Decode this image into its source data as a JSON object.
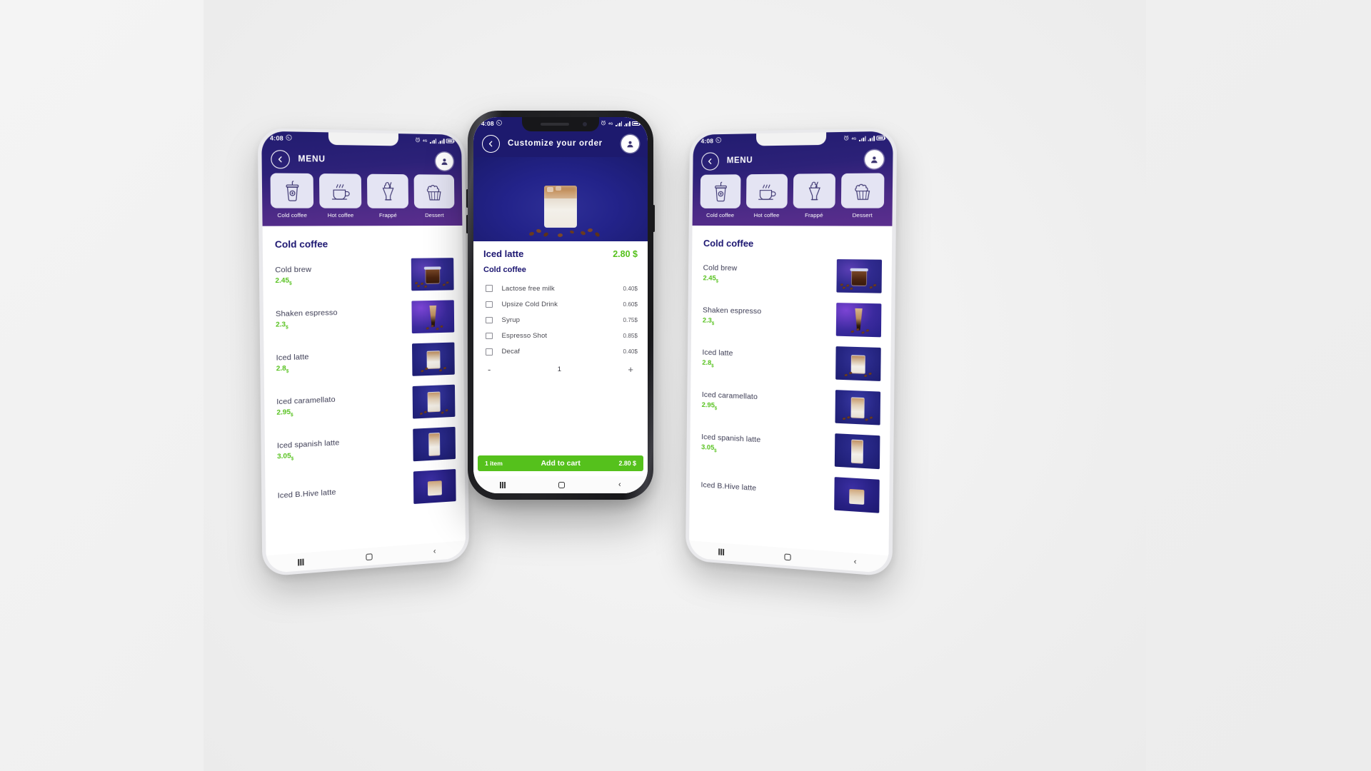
{
  "status_bar": {
    "time": "4:08",
    "whatsapp_icon": "whatsapp-icon",
    "alarm_icon": "alarm-icon",
    "signal_icon": "signal-icon",
    "battery_icon": "battery-icon"
  },
  "colors": {
    "header_start": "#221c70",
    "header_end": "#5b2e8e",
    "accent_green": "#55c11c",
    "brand_navy": "#1b1570",
    "tile_bg": "#e4e4f3"
  },
  "menu_screen": {
    "title": "MENU",
    "back_icon": "chevron-left-icon",
    "profile_icon": "user-avatar-icon",
    "categories": [
      {
        "label": "Cold coffee",
        "icon": "iced-cup-icon"
      },
      {
        "label": "Hot coffee",
        "icon": "hot-cup-icon"
      },
      {
        "label": "Frappé",
        "icon": "frappe-glass-icon"
      },
      {
        "label": "Dessert",
        "icon": "cupcake-icon"
      }
    ],
    "section_title": "Cold coffee",
    "items": [
      {
        "name": "Cold brew",
        "price": "2.45",
        "currency": "$"
      },
      {
        "name": "Shaken espresso",
        "price": "2.3",
        "currency": "$"
      },
      {
        "name": "Iced latte",
        "price": "2.8",
        "currency": "$"
      },
      {
        "name": "Iced caramellato",
        "price": "2.95",
        "currency": "$"
      },
      {
        "name": "Iced spanish latte",
        "price": "3.05",
        "currency": "$"
      },
      {
        "name": "Iced B.Hive latte",
        "price": "",
        "currency": ""
      }
    ]
  },
  "customize_screen": {
    "title": "Customize your order",
    "back_icon": "chevron-left-icon",
    "profile_icon": "user-avatar-icon",
    "hero_image": "iced-latte-photo",
    "item_name": "Iced latte",
    "item_price": "2.80 $",
    "item_category": "Cold coffee",
    "options": [
      {
        "label": "Lactose free milk",
        "price": "0.40$",
        "checked": false
      },
      {
        "label": "Upsize Cold Drink",
        "price": "0.60$",
        "checked": false
      },
      {
        "label": "Syrup",
        "price": "0.75$",
        "checked": false
      },
      {
        "label": "Espresso Shot",
        "price": "0.85$",
        "checked": false
      },
      {
        "label": "Decaf",
        "price": "0.40$",
        "checked": false
      }
    ],
    "quantity": {
      "minus": "-",
      "value": "1",
      "plus": "+"
    },
    "cart": {
      "items_label": "1 item",
      "action_label": "Add to cart",
      "total": "2.80 $"
    }
  },
  "nav_bar": {
    "recents_icon": "recents-icon",
    "home_icon": "home-icon",
    "back_icon": "back-icon"
  }
}
